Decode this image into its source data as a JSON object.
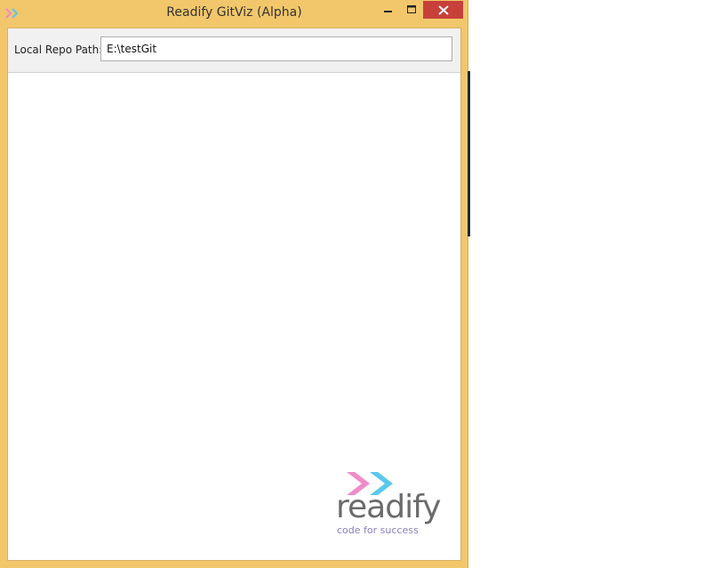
{
  "window": {
    "title": "Readify GitViz (Alpha)"
  },
  "toolbar": {
    "repo_path_label": "Local Repo Path:",
    "repo_path_value": "E:\\testGit"
  },
  "logo": {
    "word": "readify",
    "tagline": "code for success"
  },
  "colors": {
    "window_frame": "#f2c76b",
    "close_button": "#c7403a",
    "logo_pink": "#f08cc8",
    "logo_cyan": "#5cc8ee",
    "logo_text": "#6b6b6b",
    "tagline": "#8a7fc0"
  },
  "icons": {
    "app": "double-chevron-icon",
    "minimize": "minimize-icon",
    "maximize": "maximize-icon",
    "close": "close-icon"
  }
}
